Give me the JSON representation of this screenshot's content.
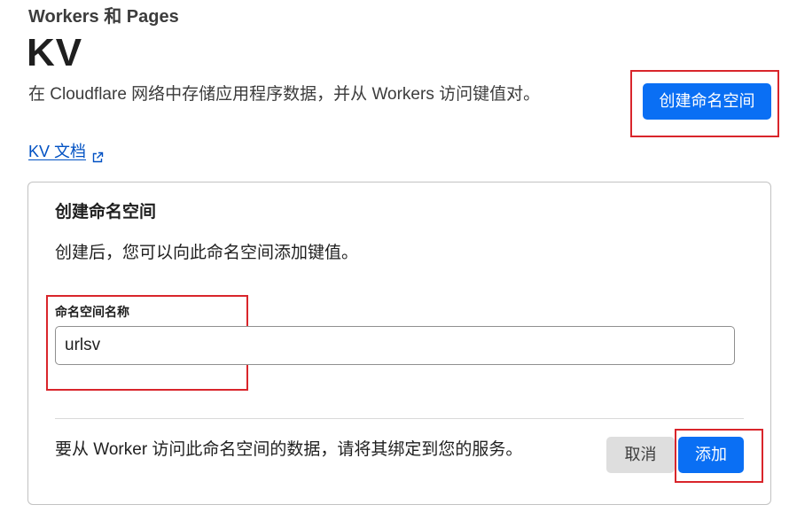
{
  "header": {
    "breadcrumb": "Workers 和 Pages",
    "title": "KV",
    "description": "在 Cloudflare 网络中存储应用程序数据，并从 Workers 访问键值对。",
    "create_button_label": "创建命名空间",
    "docs_link_label": "KV 文档",
    "docs_link_icon": "external-link-icon"
  },
  "card": {
    "title": "创建命名空间",
    "description": "创建后，您可以向此命名空间添加键值。",
    "field_label": "命名空间名称",
    "field_value": "urlsv",
    "footer_text": "要从 Worker 访问此命名空间的数据，请将其绑定到您的服务。",
    "cancel_label": "取消",
    "add_label": "添加"
  },
  "colors": {
    "primary": "#0a6ff4",
    "highlight": "#d9252b",
    "link": "#0051c3"
  }
}
